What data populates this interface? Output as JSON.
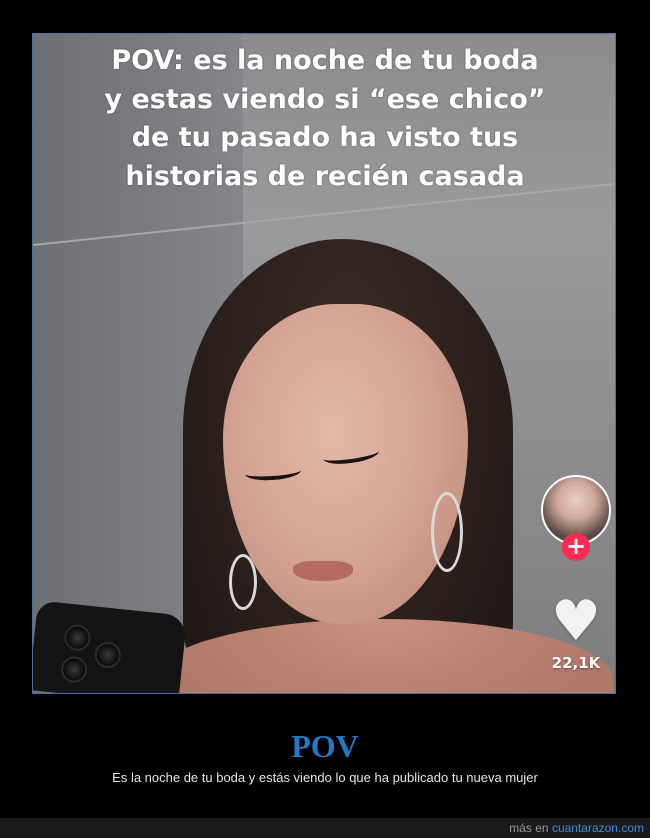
{
  "video": {
    "caption_lines": [
      "POV: es la noche de tu boda",
      "y estas viendo si “ese chico”",
      "de tu pasado ha visto tus",
      "historias de recién casada"
    ],
    "follow_symbol": "+",
    "heart_symbol": "♥",
    "likes_count": "22,1K",
    "accent_color": "#fe2c55"
  },
  "post": {
    "title": "POV",
    "description": "Es la noche de tu boda y estás viendo lo que ha publicado tu nueva mujer",
    "title_color": "#2478c8"
  },
  "footer": {
    "prefix": "más en",
    "site": "cuantarazon.com",
    "link_color": "#3b8fdc"
  }
}
